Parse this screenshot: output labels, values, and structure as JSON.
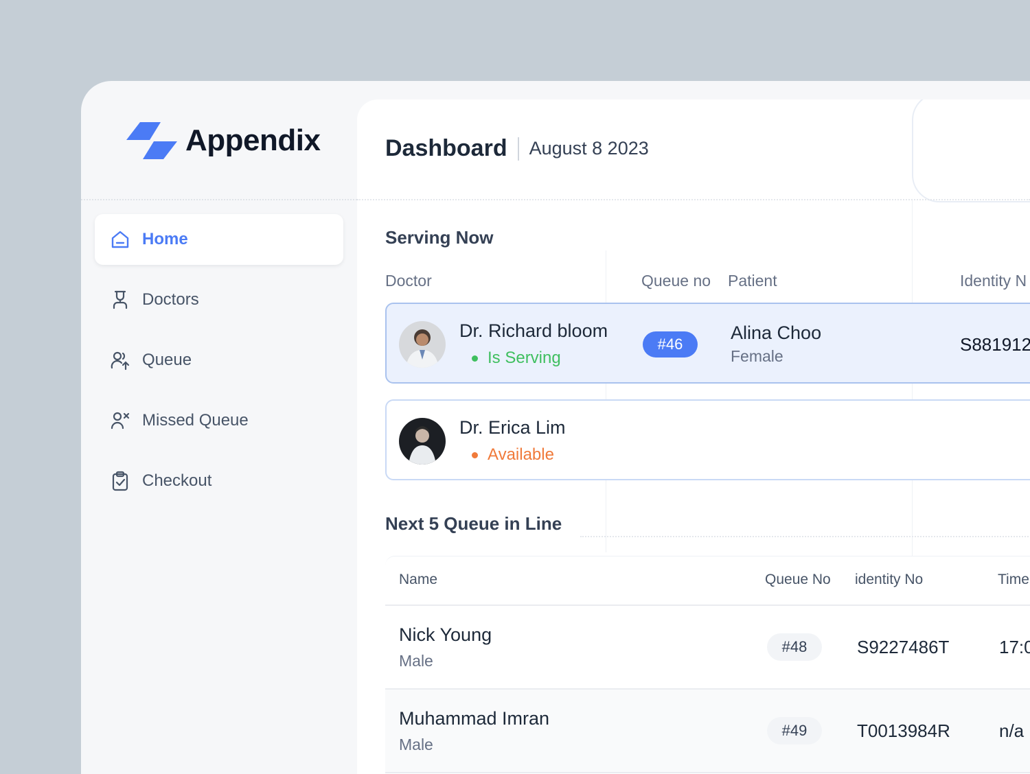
{
  "app": {
    "name": "Appendix",
    "logo_icon": "appendix-logo-icon",
    "brand_color": "#4b7bf5"
  },
  "sidebar": {
    "items": [
      {
        "label": "Home",
        "icon": "home-icon",
        "active": true
      },
      {
        "label": "Doctors",
        "icon": "doctor-icon",
        "active": false
      },
      {
        "label": "Queue",
        "icon": "queue-icon",
        "active": false
      },
      {
        "label": "Missed Queue",
        "icon": "missed-queue-icon",
        "active": false
      },
      {
        "label": "Checkout",
        "icon": "clipboard-check-icon",
        "active": false
      }
    ]
  },
  "header": {
    "title": "Dashboard",
    "date": "August 8 2023"
  },
  "serving_now": {
    "title": "Serving Now",
    "columns": {
      "doctor": "Doctor",
      "queue_no": "Queue no",
      "patient": "Patient",
      "identity": "Identity N"
    },
    "rows": [
      {
        "doctor": "Dr. Richard bloom",
        "status": "Is Serving",
        "status_color": "#3fbf5f",
        "queue_no": "#46",
        "patient_name": "Alina Choo",
        "patient_gender": "Female",
        "identity": "S881912"
      },
      {
        "doctor": "Dr. Erica Lim",
        "status": "Available",
        "status_color": "#f07a3a"
      }
    ]
  },
  "next_queue": {
    "title": "Next 5 Queue in Line",
    "columns": {
      "name": "Name",
      "queue_no": "Queue No",
      "identity": "identity No",
      "time": "Time"
    },
    "rows": [
      {
        "name": "Nick Young",
        "gender": "Male",
        "queue_no": "#48",
        "identity": "S9227486T",
        "time": "17:0"
      },
      {
        "name": "Muhammad Imran",
        "gender": "Male",
        "queue_no": "#49",
        "identity": "T0013984R",
        "time": "n/a"
      }
    ]
  }
}
